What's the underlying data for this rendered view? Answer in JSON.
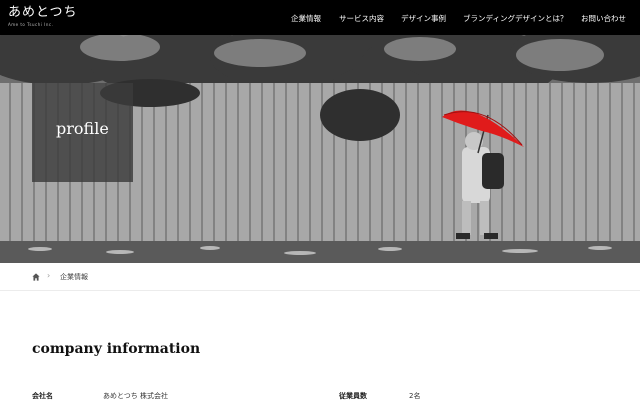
{
  "header": {
    "logo_text": "あめとつち",
    "logo_subtext": "Ame to Tsuchi Inc.",
    "nav": [
      {
        "label": "企業情報"
      },
      {
        "label": "サービス内容"
      },
      {
        "label": "デザイン事例"
      },
      {
        "label": "ブランディングデザインとは？"
      },
      {
        "label": "お問い合わせ"
      }
    ]
  },
  "hero": {
    "label": "profile",
    "accent_color": "#e01b1b"
  },
  "breadcrumb": {
    "home_icon": "home-icon",
    "current": "企業情報"
  },
  "main": {
    "section_title": "company information",
    "info": [
      {
        "label": "会社名",
        "value": "あめとつち 株式会社"
      },
      {
        "label": "従業員数",
        "value": "2名"
      }
    ]
  }
}
